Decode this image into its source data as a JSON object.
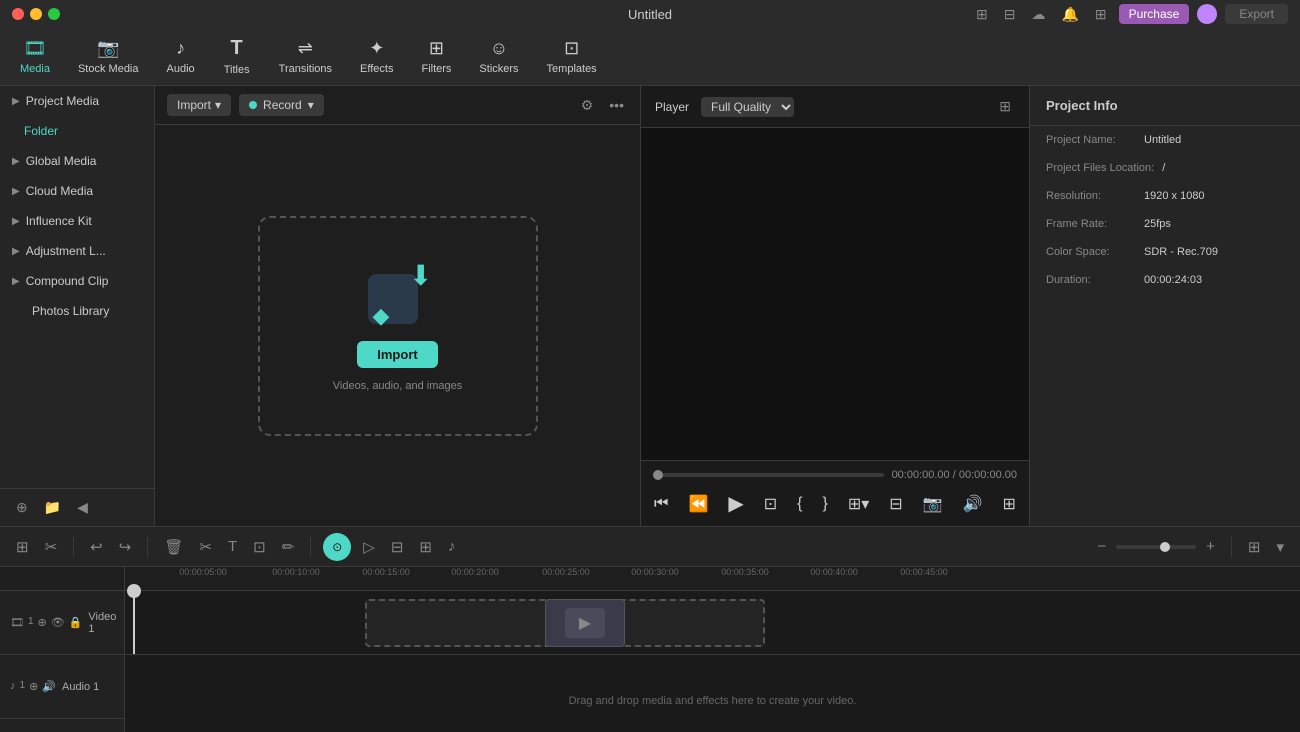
{
  "titleBar": {
    "title": "Untitled",
    "purchaseLabel": "Purchase",
    "exportLabel": "Export"
  },
  "toolbar": {
    "items": [
      {
        "id": "media",
        "label": "Media",
        "icon": "🎞",
        "active": true
      },
      {
        "id": "stock-media",
        "label": "Stock Media",
        "icon": "📷"
      },
      {
        "id": "audio",
        "label": "Audio",
        "icon": "♪"
      },
      {
        "id": "titles",
        "label": "Titles",
        "icon": "T"
      },
      {
        "id": "transitions",
        "label": "Transitions",
        "icon": "⇌"
      },
      {
        "id": "effects",
        "label": "Effects",
        "icon": "✦"
      },
      {
        "id": "filters",
        "label": "Filters",
        "icon": "⊞"
      },
      {
        "id": "stickers",
        "label": "Stickers",
        "icon": "☺"
      },
      {
        "id": "templates",
        "label": "Templates",
        "icon": "⊡"
      }
    ]
  },
  "leftPanel": {
    "items": [
      {
        "id": "project-media",
        "label": "Project Media",
        "hasArrow": true
      },
      {
        "id": "folder",
        "label": "Folder",
        "isActive": true
      },
      {
        "id": "global-media",
        "label": "Global Media",
        "hasArrow": true
      },
      {
        "id": "cloud-media",
        "label": "Cloud Media",
        "hasArrow": true
      },
      {
        "id": "influence-kit",
        "label": "Influence Kit",
        "hasArrow": true
      },
      {
        "id": "adjustment-l",
        "label": "Adjustment L...",
        "hasArrow": true
      },
      {
        "id": "compound-clip",
        "label": "Compound Clip",
        "hasArrow": true
      },
      {
        "id": "photos-library",
        "label": "Photos Library",
        "noArrow": true
      }
    ]
  },
  "mediaArea": {
    "importLabel": "Import",
    "recordLabel": "Record",
    "importBoxLabel": "Import",
    "importBoxSubtext": "Videos, audio, and images"
  },
  "player": {
    "playerLabel": "Player",
    "qualityLabel": "Full Quality",
    "currentTime": "00:00:00.00",
    "totalTime": "00:00:00.00",
    "timeSeparator": "/"
  },
  "projectInfo": {
    "title": "Project Info",
    "projectNameLabel": "Project Name:",
    "projectNameValue": "Untitled",
    "projectFilesLabel": "Project Files Location:",
    "projectFilesValue": "/",
    "resolutionLabel": "Resolution:",
    "resolutionValue": "1920 x 1080",
    "frameRateLabel": "Frame Rate:",
    "frameRateValue": "25fps",
    "colorSpaceLabel": "Color Space:",
    "colorSpaceValue": "SDR - Rec.709",
    "durationLabel": "Duration:",
    "durationValue": "00:00:24:03"
  },
  "timeline": {
    "rulerMarks": [
      {
        "time": "00:00:05:00",
        "offset": 70
      },
      {
        "time": "00:00:10:00",
        "offset": 163
      },
      {
        "time": "00:00:15:00",
        "offset": 253
      },
      {
        "time": "00:00:20:00",
        "offset": 342
      },
      {
        "time": "00:00:25:00",
        "offset": 433
      },
      {
        "time": "00:00:30:00",
        "offset": 522
      },
      {
        "time": "00:00:35:00",
        "offset": 612
      },
      {
        "time": "00:00:40:00",
        "offset": 701
      },
      {
        "time": "00:00:45:00",
        "offset": 791
      }
    ],
    "dropHint": "Drag and drop media and effects here to create your video.",
    "tracks": [
      {
        "id": "video1",
        "label": "Video 1",
        "type": "video"
      },
      {
        "id": "audio1",
        "label": "Audio 1",
        "type": "audio"
      }
    ]
  }
}
